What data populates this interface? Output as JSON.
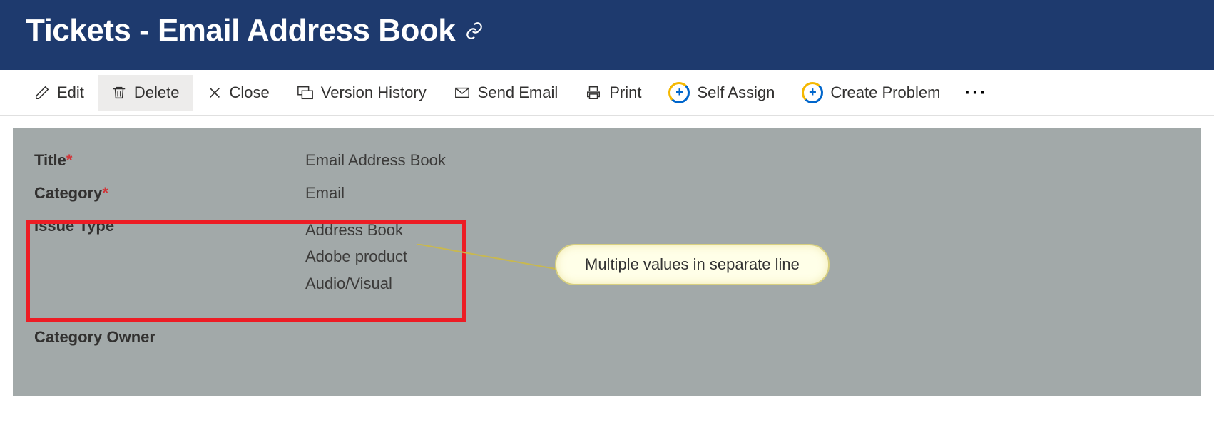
{
  "header": {
    "title": "Tickets - Email Address Book"
  },
  "toolbar": {
    "edit": "Edit",
    "delete": "Delete",
    "close": "Close",
    "version_history": "Version History",
    "send_email": "Send Email",
    "print": "Print",
    "self_assign": "Self Assign",
    "create_problem": "Create Problem"
  },
  "form": {
    "title_label": "Title",
    "title_value": "Email Address Book",
    "category_label": "Category",
    "category_value": "Email",
    "issue_type_label": "Issue Type",
    "issue_type_values": [
      "Address Book",
      "Adobe product",
      "Audio/Visual"
    ],
    "category_owner_label": "Category Owner"
  },
  "annotation": {
    "callout_text": "Multiple values in separate line"
  }
}
